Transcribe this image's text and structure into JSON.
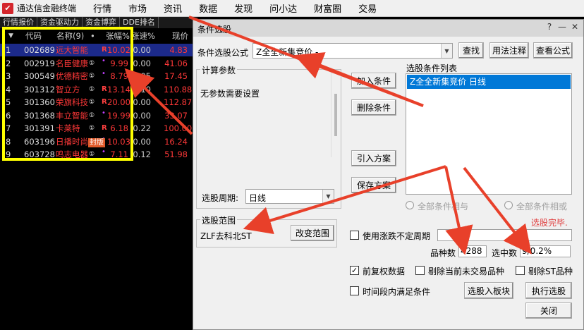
{
  "app": {
    "title": "通达信金融终端",
    "logo_glyph": "✔"
  },
  "menu": [
    "行情",
    "市场",
    "资讯",
    "数据",
    "发现",
    "问小达",
    "财富圈",
    "交易"
  ],
  "subtabs": [
    "行情报价",
    "资金驱动力",
    "资金博弈",
    "DDE排名"
  ],
  "stocklist": {
    "headers": {
      "code": "代码",
      "name": "名称(9)",
      "dot": "•",
      "pct": "张幅%",
      "speed": "涨速%",
      "price": "现价"
    },
    "rows": [
      {
        "idx": "1",
        "code": "002689",
        "name": "远大智能",
        "badge": "",
        "r": "R",
        "pct": "10.02",
        "speed": "0.00",
        "price": "4.83",
        "color": "up"
      },
      {
        "idx": "2",
        "code": "002919",
        "name": "名臣健康",
        "badge": "①",
        "r": "",
        "pct": "9.99",
        "speed": "0.00",
        "price": "41.06",
        "color": "up"
      },
      {
        "idx": "3",
        "code": "300549",
        "name": "优德精密",
        "badge": "①",
        "r": "",
        "pct": "8.79",
        "speed": "0.05",
        "price": "17.45",
        "color": "up"
      },
      {
        "idx": "4",
        "code": "301312",
        "name": "智立方",
        "badge": "①",
        "r": "R",
        "pct": "13.14",
        "speed": "0.10",
        "price": "110.88",
        "color": "up"
      },
      {
        "idx": "5",
        "code": "301360",
        "name": "荣旗科技",
        "badge": "①",
        "r": "R",
        "pct": "20.00",
        "speed": "0.00",
        "price": "112.87",
        "color": "up"
      },
      {
        "idx": "6",
        "code": "301368",
        "name": "丰立智能",
        "badge": "①",
        "r": "",
        "pct": "19.99",
        "speed": "0.00",
        "price": "33.07",
        "color": "up"
      },
      {
        "idx": "7",
        "code": "301391",
        "name": "卡莱特",
        "badge": "①",
        "r": "R",
        "pct": "6.18",
        "speed": "0.22",
        "price": "100.00",
        "color": "up"
      },
      {
        "idx": "8",
        "code": "603196",
        "name": "日播时尚",
        "badge": "",
        "r": "",
        "pct": "10.03",
        "speed": "0.00",
        "price": "16.24",
        "color": "up"
      },
      {
        "idx": "9",
        "code": "603728",
        "name": "鸣志电器",
        "badge": "①",
        "r": "",
        "pct": "7.11",
        "speed": "0.12",
        "price": "51.98",
        "color": "up"
      }
    ],
    "stamp": "封版"
  },
  "dialog": {
    "title": "条件选股",
    "formula_label": "条件选股公式",
    "formula_value": "Z全全新集竞价  -",
    "buttons": {
      "find": "查找",
      "usage": "用法注释",
      "view_formula": "查看公式",
      "add_condition": "加入条件",
      "delete_condition": "删除条件",
      "import_plan": "引入方案",
      "save_plan": "保存方案",
      "change_range": "改变范围",
      "to_block": "选股入板块",
      "execute": "执行选股",
      "close": "关闭"
    },
    "calc_params": {
      "title": "计算参数",
      "text": "无参数需要设置"
    },
    "period_label": "选股周期:",
    "period_value": "日线",
    "condition_list": {
      "title": "选股条件列表",
      "items": [
        "Z全全新集竞价  日线"
      ]
    },
    "radio_and": "全部条件相与",
    "radio_or": "全部条件相或",
    "status": "选股完毕.",
    "range": {
      "title": "选股范围",
      "value": "ZLF去科北ST"
    },
    "use_period_label": "使用涨跌不定周期",
    "count_label": "品种数",
    "count_value": "4288",
    "selected_label": "选中数",
    "selected_value": "9/0.2%",
    "adj_label": "前复权数据",
    "exclude_untraded": "剔除当前未交易品种",
    "exclude_st": "剔除ST品种",
    "time_period": "时间段内满足条件"
  }
}
